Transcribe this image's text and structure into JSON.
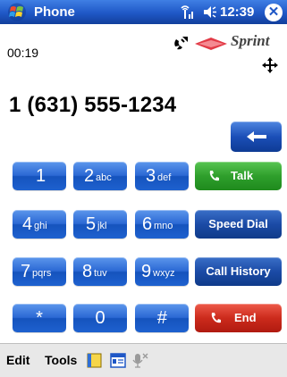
{
  "titlebar": {
    "app_title": "Phone",
    "clock": "12:39",
    "close_label": "✕",
    "colors": {
      "bar": "#1f57c6"
    }
  },
  "status": {
    "call_timer": "00:19",
    "carrier": "Sprint"
  },
  "display": {
    "dialed_number": "1 (631) 555-1234"
  },
  "keypad": {
    "keys": [
      {
        "digit": "1",
        "letters": ""
      },
      {
        "digit": "2",
        "letters": "abc"
      },
      {
        "digit": "3",
        "letters": "def"
      },
      {
        "digit": "4",
        "letters": "ghi"
      },
      {
        "digit": "5",
        "letters": "jkl"
      },
      {
        "digit": "6",
        "letters": "mno"
      },
      {
        "digit": "7",
        "letters": "pqrs"
      },
      {
        "digit": "8",
        "letters": "tuv"
      },
      {
        "digit": "9",
        "letters": "wxyz"
      },
      {
        "digit": "*",
        "letters": ""
      },
      {
        "digit": "0",
        "letters": ""
      },
      {
        "digit": "#",
        "letters": ""
      }
    ]
  },
  "actions": {
    "talk": "Talk",
    "speed_dial": "Speed Dial",
    "call_history": "Call History",
    "end": "End",
    "colors": {
      "talk": "#2f9f2c",
      "end": "#cc2b1c",
      "blue": "#1b4ba6"
    }
  },
  "menubar": {
    "edit": "Edit",
    "tools": "Tools",
    "icons": [
      "notes-icon",
      "contact-card-icon",
      "microphone-icon"
    ]
  }
}
